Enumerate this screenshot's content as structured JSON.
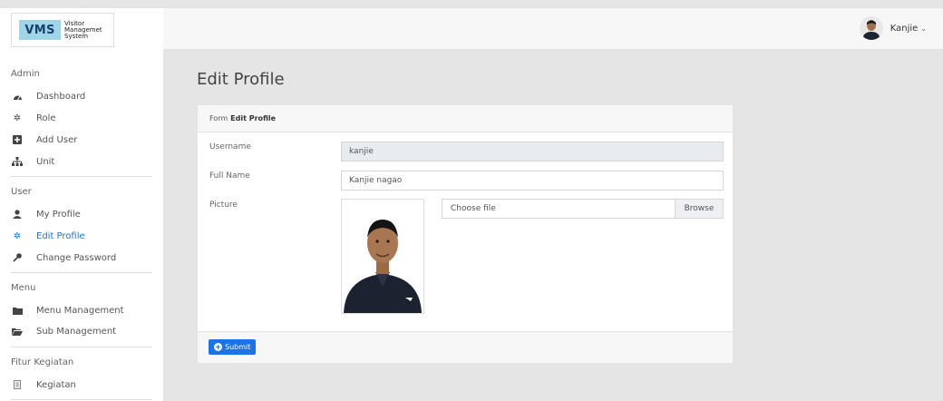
{
  "brand": {
    "logo": "VMS",
    "line1": "Visitor",
    "line2": "Managemet",
    "line3": "System"
  },
  "sidebar": {
    "sections": [
      {
        "label": "Admin"
      },
      {
        "label": "User"
      },
      {
        "label": "Menu"
      },
      {
        "label": "Fitur Kegiatan"
      }
    ],
    "items": [
      {
        "label": "Dashboard",
        "icon": "dashboard-icon"
      },
      {
        "label": "Role",
        "icon": "gear-icon"
      },
      {
        "label": "Add User",
        "icon": "plus-square-icon"
      },
      {
        "label": "Unit",
        "icon": "sitemap-icon"
      },
      {
        "label": "My Profile",
        "icon": "user-icon"
      },
      {
        "label": "Edit Profile",
        "icon": "gear-icon",
        "active": true
      },
      {
        "label": "Change Password",
        "icon": "key-icon"
      },
      {
        "label": "Menu Management",
        "icon": "folder-icon"
      },
      {
        "label": "Sub Management",
        "icon": "folder-open-icon"
      },
      {
        "label": "Kegiatan",
        "icon": "list-icon"
      }
    ]
  },
  "topbar": {
    "username": "Kanjie"
  },
  "page": {
    "title": "Edit Profile"
  },
  "form": {
    "header_prefix": "Form",
    "header_bold": "Edit Profile",
    "username_label": "Username",
    "username_value": "kanjie",
    "fullname_label": "Full Name",
    "fullname_value": "Kanjie nagao",
    "picture_label": "Picture",
    "file_placeholder": "Choose file",
    "browse_label": "Browse",
    "submit_label": "Submit"
  },
  "colors": {
    "accent": "#1a73e8",
    "logo_bg": "#9fd5e6",
    "background": "#e5e5e5"
  }
}
